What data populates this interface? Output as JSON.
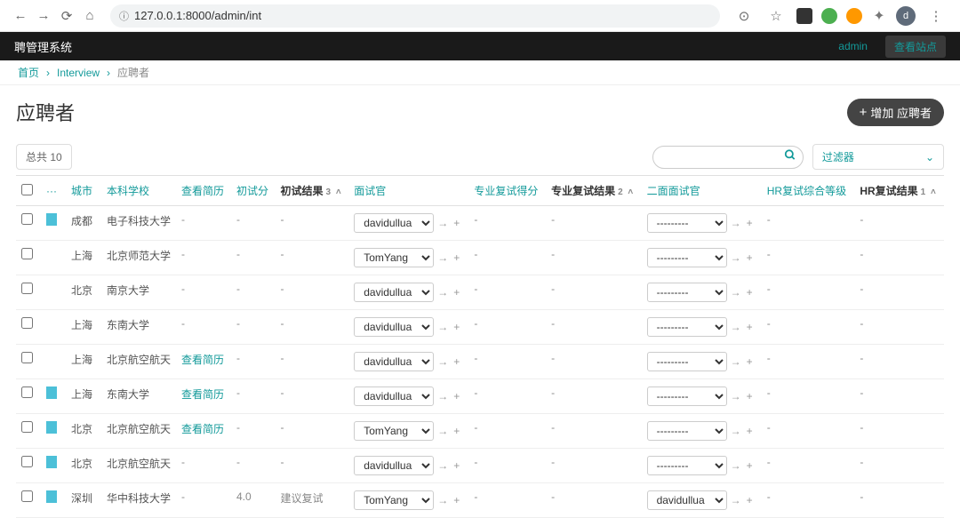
{
  "browser": {
    "url": "127.0.0.1:8000/admin/int",
    "avatar_letter": "d"
  },
  "topbar": {
    "brand": "聘管理系统",
    "user": "admin",
    "view_site": "查看站点"
  },
  "breadcrumb": {
    "home": "首页",
    "section": "Interview",
    "current": "应聘者"
  },
  "page": {
    "title": "应聘者",
    "add_label": "增加 应聘者",
    "total_label": "总共 10",
    "filter_label": "过滤器"
  },
  "columns": {
    "c1": "城市",
    "c2": "本科学校",
    "c3": "查看简历",
    "c4": "初试分",
    "c5": "初试结果",
    "c5_sort": "3",
    "c6": "面试官",
    "c7": "专业复试得分",
    "c8": "专业复试结果",
    "c8_sort": "2",
    "c9": "二面面试官",
    "c10": "HR复试综合等级",
    "c11": "HR复试结果",
    "c11_sort": "1"
  },
  "rows": [
    {
      "thumb": true,
      "city": "成都",
      "school": "电子科技大学",
      "resume": "-",
      "score1": "-",
      "result1": "-",
      "interviewer1": "davidullua",
      "score2": "-",
      "result2": "-",
      "interviewer2": "---------",
      "hrgrade": "-",
      "hrresult": "-"
    },
    {
      "thumb": false,
      "city": "上海",
      "school": "北京师范大学",
      "resume": "-",
      "score1": "-",
      "result1": "-",
      "interviewer1": "TomYang",
      "score2": "-",
      "result2": "-",
      "interviewer2": "---------",
      "hrgrade": "-",
      "hrresult": "-"
    },
    {
      "thumb": false,
      "city": "北京",
      "school": "南京大学",
      "resume": "-",
      "score1": "-",
      "result1": "-",
      "interviewer1": "davidullua",
      "score2": "-",
      "result2": "-",
      "interviewer2": "---------",
      "hrgrade": "-",
      "hrresult": "-"
    },
    {
      "thumb": false,
      "city": "上海",
      "school": "东南大学",
      "resume": "-",
      "score1": "-",
      "result1": "-",
      "interviewer1": "davidullua",
      "score2": "-",
      "result2": "-",
      "interviewer2": "---------",
      "hrgrade": "-",
      "hrresult": "-"
    },
    {
      "thumb": false,
      "city": "上海",
      "school": "北京航空航天",
      "resume": "查看简历",
      "resume_link": true,
      "score1": "-",
      "result1": "-",
      "interviewer1": "davidullua",
      "score2": "-",
      "result2": "-",
      "interviewer2": "---------",
      "hrgrade": "-",
      "hrresult": "-"
    },
    {
      "thumb": true,
      "city": "上海",
      "school": "东南大学",
      "resume": "查看简历",
      "resume_link": true,
      "score1": "-",
      "result1": "-",
      "interviewer1": "davidullua",
      "score2": "-",
      "result2": "-",
      "interviewer2": "---------",
      "hrgrade": "-",
      "hrresult": "-"
    },
    {
      "thumb": true,
      "city": "北京",
      "school": "北京航空航天",
      "resume": "查看简历",
      "resume_link": true,
      "score1": "-",
      "result1": "-",
      "interviewer1": "TomYang",
      "score2": "-",
      "result2": "-",
      "interviewer2": "---------",
      "hrgrade": "-",
      "hrresult": "-"
    },
    {
      "thumb": true,
      "city": "北京",
      "school": "北京航空航天",
      "resume": "-",
      "score1": "-",
      "result1": "-",
      "interviewer1": "davidullua",
      "score2": "-",
      "result2": "-",
      "interviewer2": "---------",
      "hrgrade": "-",
      "hrresult": "-"
    },
    {
      "thumb": true,
      "city": "深圳",
      "school": "华中科技大学",
      "resume": "-",
      "score1": "4.0",
      "result1": "建议复试",
      "interviewer1": "TomYang",
      "score2": "-",
      "result2": "-",
      "interviewer2": "davidullua",
      "hrgrade": "-",
      "hrresult": "-"
    }
  ]
}
